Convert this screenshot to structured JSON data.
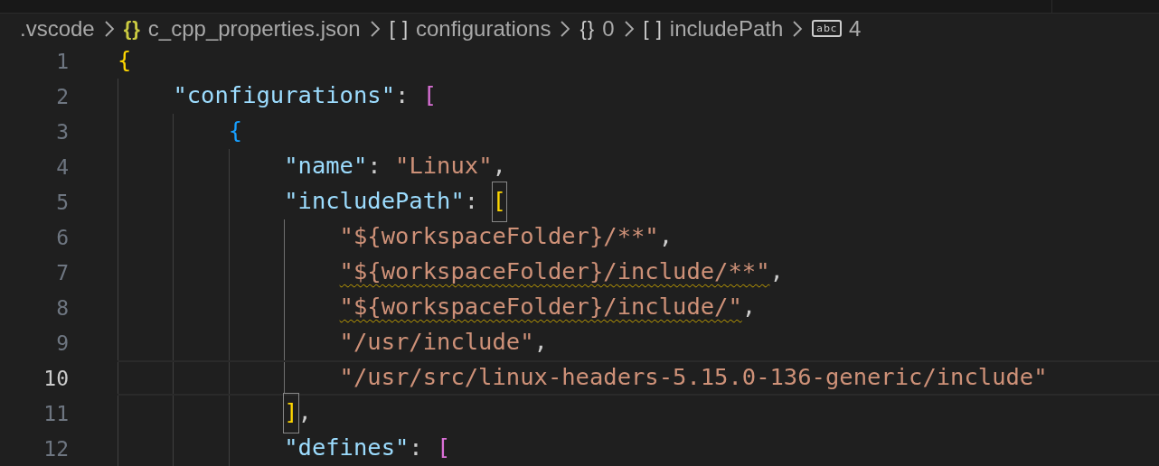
{
  "breadcrumb": [
    {
      "kind": "folder",
      "label": ".vscode"
    },
    {
      "kind": "file",
      "icon": "{}",
      "label": "c_cpp_properties.json"
    },
    {
      "kind": "array",
      "icon": "[ ]",
      "label": "configurations"
    },
    {
      "kind": "object",
      "icon": "{}",
      "label": "0"
    },
    {
      "kind": "array",
      "icon": "[ ]",
      "label": "includePath"
    },
    {
      "kind": "string",
      "icon": "abc",
      "label": "4"
    }
  ],
  "lines": [
    {
      "number": "1",
      "selected": false,
      "tokens": [
        {
          "kind": "gold",
          "text": "{"
        }
      ],
      "children": [
        {
          "number": "2",
          "selected": false,
          "tokens": [
            {
              "kind": "key",
              "text": "\"configurations\""
            },
            {
              "kind": "punct",
              "text": ": "
            },
            {
              "kind": "violet",
              "text": "["
            }
          ],
          "children": [
            {
              "number": "3",
              "selected": false,
              "tokens": [
                {
                  "kind": "blue",
                  "text": "{"
                }
              ],
              "children": [
                {
                  "number": "4",
                  "selected": false,
                  "tokens": [
                    {
                      "kind": "key",
                      "text": "\"name\""
                    },
                    {
                      "kind": "punct",
                      "text": ": "
                    },
                    {
                      "kind": "string",
                      "text": "\"Linux\""
                    },
                    {
                      "kind": "punct",
                      "text": ","
                    }
                  ]
                },
                {
                  "number": "5",
                  "selected": false,
                  "active_guide": true,
                  "tokens": [
                    {
                      "kind": "key",
                      "text": "\"includePath\""
                    },
                    {
                      "kind": "punct",
                      "text": ": "
                    },
                    {
                      "kind": "gold",
                      "text": "[",
                      "matched": true
                    }
                  ],
                  "children": [
                    {
                      "number": "6",
                      "selected": false,
                      "tokens": [
                        {
                          "kind": "string",
                          "text": "\"${workspaceFolder}/**\""
                        },
                        {
                          "kind": "punct",
                          "text": ","
                        }
                      ]
                    },
                    {
                      "number": "7",
                      "selected": false,
                      "tokens": [
                        {
                          "kind": "string",
                          "text": "\"${workspaceFolder}/include/**\"",
                          "warning": true
                        },
                        {
                          "kind": "punct",
                          "text": ","
                        }
                      ]
                    },
                    {
                      "number": "8",
                      "selected": false,
                      "tokens": [
                        {
                          "kind": "string",
                          "text": "\"${workspaceFolder}/include/\"",
                          "warning": true
                        },
                        {
                          "kind": "punct",
                          "text": ","
                        }
                      ]
                    },
                    {
                      "number": "9",
                      "selected": false,
                      "tokens": [
                        {
                          "kind": "string",
                          "text": "\"/usr/include\""
                        },
                        {
                          "kind": "punct",
                          "text": ","
                        }
                      ]
                    },
                    {
                      "number": "10",
                      "selected": true,
                      "tokens": [
                        {
                          "kind": "string",
                          "text": "\"/usr/src/linux-headers-5.15.0-136-generic/include\""
                        }
                      ]
                    }
                  ]
                },
                {
                  "number": "11",
                  "selected": false,
                  "tokens": [
                    {
                      "kind": "gold",
                      "text": "]",
                      "matched": true
                    },
                    {
                      "kind": "punct",
                      "text": ","
                    }
                  ]
                },
                {
                  "number": "12",
                  "selected": false,
                  "tokens": [
                    {
                      "kind": "key",
                      "text": "\"defines\""
                    },
                    {
                      "kind": "punct",
                      "text": ": "
                    },
                    {
                      "kind": "violet",
                      "text": "["
                    }
                  ]
                }
              ]
            }
          ]
        }
      ]
    }
  ]
}
